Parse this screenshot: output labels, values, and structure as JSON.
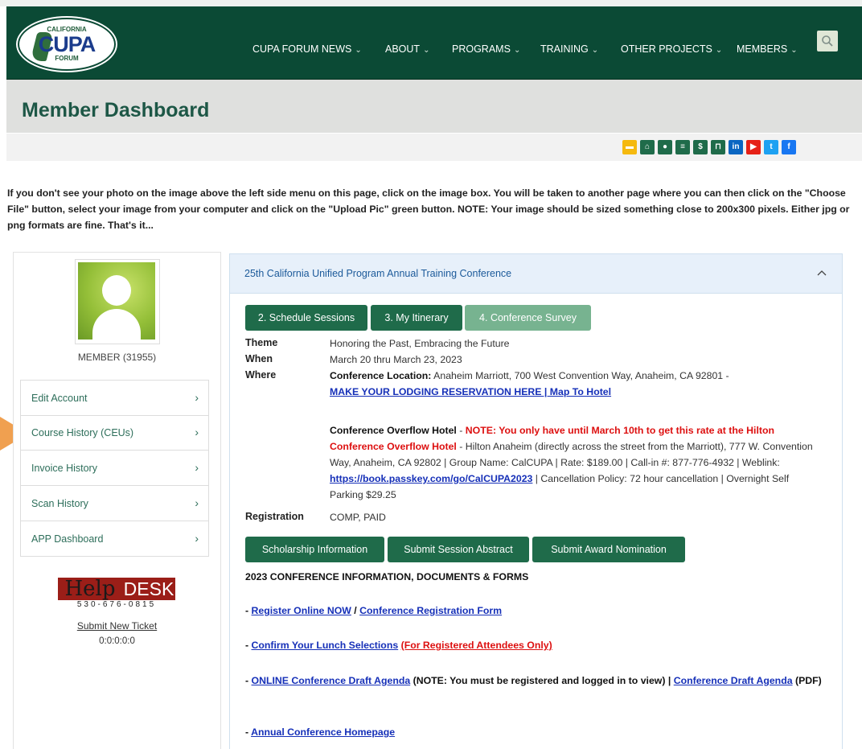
{
  "logo": {
    "top": "CALIFORNIA",
    "main": "CUPA",
    "bottom": "FORUM"
  },
  "nav": {
    "items": [
      {
        "label": "CUPA FORUM NEWS"
      },
      {
        "label": "ABOUT"
      },
      {
        "label": "PROGRAMS"
      },
      {
        "label": "TRAINING"
      },
      {
        "label": "OTHER PROJECTS"
      },
      {
        "label": "MEMBERS"
      }
    ],
    "chevron": "⌄"
  },
  "page": {
    "title": "Member Dashboard"
  },
  "notice": "If you don't see your photo on the image above the left side menu on this page, click on the image box. You will be taken to another page where you can then click on the \"Choose File\" button, select your image from your computer and click on the \"Upload Pic\" green button. NOTE: Your image should be sized something close to 200x300 pixels. Either jpg or png formats are fine. That's it...",
  "sidebar": {
    "member_label": "MEMBER (31955)",
    "menu": [
      {
        "label": "Edit Account"
      },
      {
        "label": "Course History (CEUs)"
      },
      {
        "label": "Invoice History"
      },
      {
        "label": "Scan History"
      },
      {
        "label": "APP Dashboard"
      }
    ],
    "arrow": "›",
    "helpdesk": {
      "help": "Help",
      "desk": "DESK",
      "phone": "530-676-0815"
    },
    "submit_ticket": "Submit New Ticket",
    "counter": "0:0:0:0:0"
  },
  "conference": {
    "panel_title": "25th California Unified Program Annual Training Conference",
    "buttons": [
      "2. Schedule Sessions",
      "3. My Itinerary",
      "4. Conference Survey"
    ],
    "theme_label": "Theme",
    "theme": "Honoring the Past, Embracing the Future",
    "when_label": "When",
    "when": "March 20 thru March 23, 2023",
    "where_label": "Where",
    "location_label": "Conference Location:",
    "location": "Anaheim Marriott, 700 West Convention Way, Anaheim, CA 92801 -",
    "lodging_link": "MAKE YOUR LODGING RESERVATION HERE | Map To Hotel",
    "overflow_label": "Conference Overflow Hotel",
    "overflow_sep": " - ",
    "overflow_note": "NOTE:  You only have until March 10th to get this rate at the Hilton Conference Overflow Hotel",
    "overflow_text": " - Hilton Anaheim (directly across the street from the Marriott), 777 W. Convention Way, Anaheim, CA 92802 | Group Name: CalCUPA | Rate: $189.00 | Call-in #: 877-776-4932 | Weblink: ",
    "weblink": "https://book.passkey.com/go/CalCUPA2023",
    "overflow_tail": " | Cancellation Policy: 72 hour cancellation | Overnight Self Parking $29.25",
    "registration_label": "Registration",
    "registration": "COMP, PAID",
    "buttons2": [
      "Scholarship Information",
      "Submit Session Abstract",
      "Submit Award Nomination"
    ],
    "docs_heading": "2023 CONFERENCE INFORMATION, DOCUMENTS & FORMS",
    "dash": "- ",
    "slash": " / ",
    "register_online": "Register Online NOW",
    "registration_form": "Conference Registration Form",
    "lunch_link": "Confirm Your Lunch Selections",
    "lunch_note": "(For Registered Attendees Only)",
    "agenda_link": "ONLINE Conference Draft Agenda",
    "agenda_note": " (NOTE: You must be registered and logged in to view)  |  ",
    "agenda_pdf_link": "Conference Draft Agenda",
    "agenda_pdf_note": " (PDF)",
    "homepage_link": "Annual Conference Homepage"
  },
  "toolbar_icons": [
    {
      "icon": "id-card-icon",
      "color": "#f5b90f"
    },
    {
      "icon": "home-icon",
      "color": "#1f6b4a"
    },
    {
      "icon": "user-icon",
      "color": "#1f6b4a"
    },
    {
      "icon": "list-icon",
      "color": "#1f6b4a"
    },
    {
      "icon": "dollar-icon",
      "color": "#1f6b4a"
    },
    {
      "icon": "cart-icon",
      "color": "#1f6b4a"
    },
    {
      "icon": "linkedin-icon",
      "color": "#0a66c2"
    },
    {
      "icon": "youtube-icon",
      "color": "#e62117"
    },
    {
      "icon": "twitter-icon",
      "color": "#1da1f2"
    },
    {
      "icon": "facebook-icon",
      "color": "#1877f2"
    }
  ]
}
